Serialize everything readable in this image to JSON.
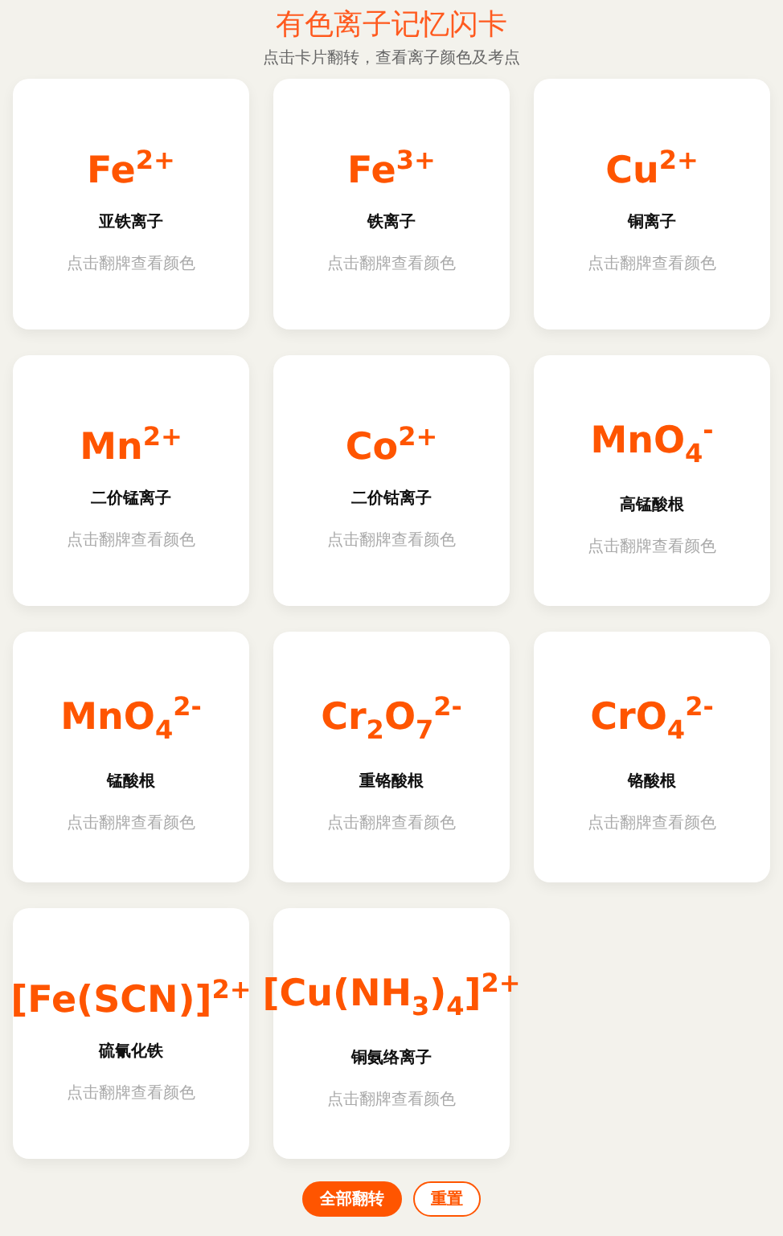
{
  "title": "有色离子记忆闪卡",
  "subtitle": "点击卡片翻转，查看离子颜色及考点",
  "cards": [
    {
      "formula": "Fe$^{2+}$",
      "name": "亚铁离子",
      "hint": "点击翻牌查看颜色"
    },
    {
      "formula": "Fe$^{3+}$",
      "name": "铁离子",
      "hint": "点击翻牌查看颜色"
    },
    {
      "formula": "Cu$^{2+}$",
      "name": "铜离子",
      "hint": "点击翻牌查看颜色"
    },
    {
      "formula": "Mn$^{2+}$",
      "name": "二价锰离子",
      "hint": "点击翻牌查看颜色"
    },
    {
      "formula": "Co$^{2+}$",
      "name": "二价钴离子",
      "hint": "点击翻牌查看颜色"
    },
    {
      "formula": "MnO$_{4}$$^{-}$",
      "name": "高锰酸根",
      "hint": "点击翻牌查看颜色"
    },
    {
      "formula": "MnO$_{4}$$^{2-}$",
      "name": "锰酸根",
      "hint": "点击翻牌查看颜色"
    },
    {
      "formula": "Cr$_{2}$O$_{7}$$^{2-}$",
      "name": "重铬酸根",
      "hint": "点击翻牌查看颜色"
    },
    {
      "formula": "CrO$_{4}$$^{2-}$",
      "name": "铬酸根",
      "hint": "点击翻牌查看颜色"
    },
    {
      "formula": "[Fe(SCN)]$^{2+}$",
      "name": "硫氰化铁",
      "hint": "点击翻牌查看颜色"
    },
    {
      "formula": "[Cu(NH$_{3}$)$_{4}$]$^{2+}$",
      "name": "铜氨络离子",
      "hint": "点击翻牌查看颜色"
    }
  ],
  "buttons": [
    {
      "label": "全部翻转",
      "kind": "primary"
    },
    {
      "label": "重置",
      "kind": "outline"
    }
  ]
}
